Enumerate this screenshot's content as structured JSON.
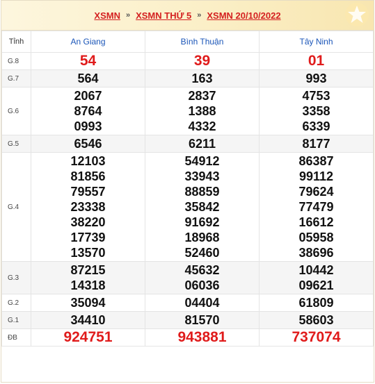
{
  "breadcrumb": {
    "items": [
      "XSMN",
      "XSMN THỨ 5",
      "XSMN 20/10/2022"
    ],
    "separator": "»"
  },
  "table": {
    "corner_label": "Tỉnh",
    "provinces": [
      "An Giang",
      "Bình Thuận",
      "Tây Ninh"
    ],
    "rows": [
      {
        "prize": "G.8",
        "values": [
          [
            "54"
          ],
          [
            "39"
          ],
          [
            "01"
          ]
        ]
      },
      {
        "prize": "G.7",
        "values": [
          [
            "564"
          ],
          [
            "163"
          ],
          [
            "993"
          ]
        ]
      },
      {
        "prize": "G.6",
        "values": [
          [
            "2067",
            "8764",
            "0993"
          ],
          [
            "2837",
            "1388",
            "4332"
          ],
          [
            "4753",
            "3358",
            "6339"
          ]
        ]
      },
      {
        "prize": "G.5",
        "values": [
          [
            "6546"
          ],
          [
            "6211"
          ],
          [
            "8177"
          ]
        ]
      },
      {
        "prize": "G.4",
        "values": [
          [
            "12103",
            "81856",
            "79557",
            "23338",
            "38220",
            "17739",
            "13570"
          ],
          [
            "54912",
            "33943",
            "88859",
            "35842",
            "91692",
            "18968",
            "52460"
          ],
          [
            "86387",
            "99112",
            "79624",
            "77479",
            "16612",
            "05958",
            "38696"
          ]
        ]
      },
      {
        "prize": "G.3",
        "values": [
          [
            "87215",
            "14318"
          ],
          [
            "45632",
            "06036"
          ],
          [
            "10442",
            "09621"
          ]
        ]
      },
      {
        "prize": "G.2",
        "values": [
          [
            "35094"
          ],
          [
            "04404"
          ],
          [
            "61809"
          ]
        ]
      },
      {
        "prize": "G.1",
        "values": [
          [
            "34410"
          ],
          [
            "81570"
          ],
          [
            "58603"
          ]
        ]
      },
      {
        "prize": "ĐB",
        "values": [
          [
            "924751"
          ],
          [
            "943881"
          ],
          [
            "737074"
          ]
        ]
      }
    ]
  },
  "colors": {
    "link_red": "#d42020",
    "province_blue": "#1a55b8",
    "highlight_red": "#e01b1b",
    "alt_row": "#f5f5f5"
  },
  "icons": {
    "header_decoration": "star-icon"
  }
}
